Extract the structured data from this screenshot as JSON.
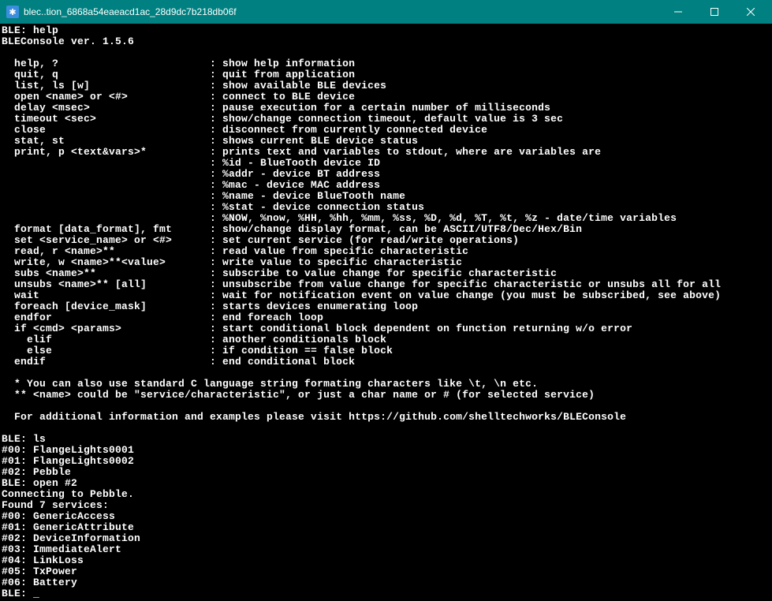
{
  "titlebar": {
    "icon_glyph": "✱",
    "title": "blec..tion_6868a54eaeacd1ac_28d9dc7b218db06f"
  },
  "console": {
    "prompt": "BLE:",
    "command_help": "help",
    "version": "BLEConsole ver. 1.5.6",
    "empty": "",
    "help_rows": [
      {
        "cmd": "  help, ?",
        "desc": "show help information"
      },
      {
        "cmd": "  quit, q",
        "desc": "quit from application"
      },
      {
        "cmd": "  list, ls [w]",
        "desc": "show available BLE devices"
      },
      {
        "cmd": "  open <name> or <#>",
        "desc": "connect to BLE device"
      },
      {
        "cmd": "  delay <msec>",
        "desc": "pause execution for a certain number of milliseconds"
      },
      {
        "cmd": "  timeout <sec>",
        "desc": "show/change connection timeout, default value is 3 sec"
      },
      {
        "cmd": "  close",
        "desc": "disconnect from currently connected device"
      },
      {
        "cmd": "  stat, st",
        "desc": "shows current BLE device status"
      },
      {
        "cmd": "  print, p <text&vars>*",
        "desc": "prints text and variables to stdout, where are variables are"
      },
      {
        "cmd": "",
        "desc": "%id - BlueTooth device ID"
      },
      {
        "cmd": "",
        "desc": "%addr - device BT address"
      },
      {
        "cmd": "",
        "desc": "%mac - device MAC address"
      },
      {
        "cmd": "",
        "desc": "%name - device BlueTooth name"
      },
      {
        "cmd": "",
        "desc": "%stat - device connection status"
      },
      {
        "cmd": "",
        "desc": "%NOW, %now, %HH, %hh, %mm, %ss, %D, %d, %T, %t, %z - date/time variables"
      },
      {
        "cmd": "  format [data_format], fmt",
        "desc": "show/change display format, can be ASCII/UTF8/Dec/Hex/Bin"
      },
      {
        "cmd": "  set <service_name> or <#>",
        "desc": "set current service (for read/write operations)"
      },
      {
        "cmd": "  read, r <name>**",
        "desc": "read value from specific characteristic"
      },
      {
        "cmd": "  write, w <name>**<value>",
        "desc": "write value to specific characteristic"
      },
      {
        "cmd": "  subs <name>**",
        "desc": "subscribe to value change for specific characteristic"
      },
      {
        "cmd": "  unsubs <name>** [all]",
        "desc": "unsubscribe from value change for specific characteristic or unsubs all for all"
      },
      {
        "cmd": "  wait",
        "desc": "wait for notification event on value change (you must be subscribed, see above)"
      },
      {
        "cmd": "  foreach [device_mask]",
        "desc": "starts devices enumerating loop"
      },
      {
        "cmd": "  endfor",
        "desc": "end foreach loop"
      },
      {
        "cmd": "  if <cmd> <params>",
        "desc": "start conditional block dependent on function returning w/o error"
      },
      {
        "cmd": "    elif",
        "desc": "another conditionals block"
      },
      {
        "cmd": "    else",
        "desc": "if condition == false block"
      },
      {
        "cmd": "  endif",
        "desc": "end conditional block"
      }
    ],
    "notes": [
      "  * You can also use standard C language string formating characters like \\t, \\n etc.",
      "  ** <name> could be \"service/characteristic\", or just a char name or # (for selected service)",
      "",
      "  For additional information and examples please visit https://github.com/shelltechworks/BLEConsole",
      ""
    ],
    "command_ls": "ls",
    "devices": [
      "#00: FlangeLights0001",
      "#01: FlangeLights0002",
      "#02: Pebble"
    ],
    "command_open": "open #2",
    "connecting": "Connecting to Pebble.",
    "found": "Found 7 services:",
    "services": [
      "#00: GenericAccess",
      "#01: GenericAttribute",
      "#02: DeviceInformation",
      "#03: ImmediateAlert",
      "#04: LinkLoss",
      "#05: TxPower",
      "#06: Battery"
    ],
    "cursor": "_"
  }
}
